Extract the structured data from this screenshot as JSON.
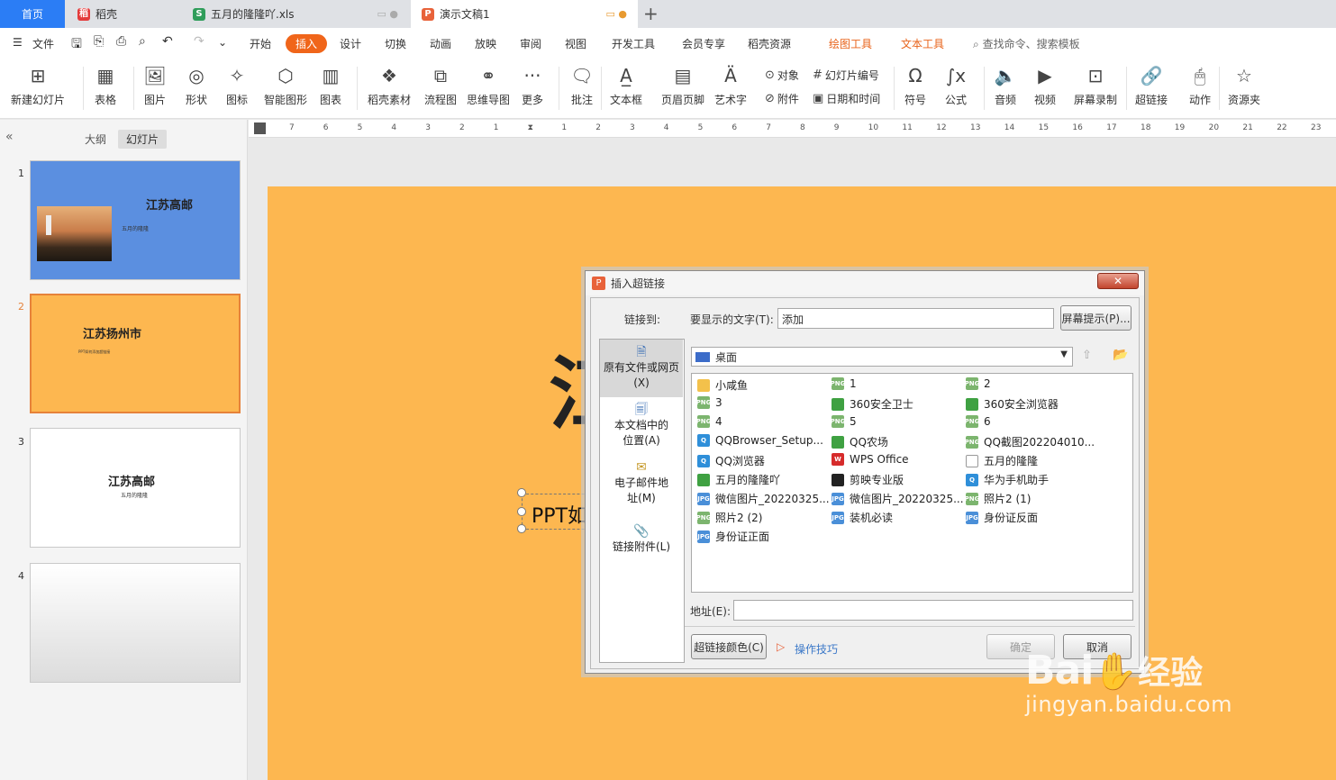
{
  "tabs": {
    "home": "首页",
    "daoke": "稻壳",
    "xls": "五月的隆隆吖.xls",
    "ppt": "演示文稿1"
  },
  "menu": {
    "file": "文件",
    "items": [
      "开始",
      "插入",
      "设计",
      "切换",
      "动画",
      "放映",
      "审阅",
      "视图",
      "开发工具",
      "会员专享",
      "稻壳资源"
    ],
    "draw": "绘图工具",
    "text": "文本工具",
    "search": "查找命令、搜索模板"
  },
  "ribbon": {
    "new_slide": "新建幻灯片",
    "table": "表格",
    "picture": "图片",
    "shape": "形状",
    "icon": "图标",
    "smart": "智能图形",
    "chart": "图表",
    "material": "稻壳素材",
    "flow": "流程图",
    "mind": "思维导图",
    "more": "更多",
    "comment": "批注",
    "textbox": "文本框",
    "header": "页眉页脚",
    "art": "艺术字",
    "object": "对象",
    "attach": "附件",
    "slide_num": "幻灯片编号",
    "datetime": "日期和时间",
    "symbol": "符号",
    "formula": "公式",
    "audio": "音频",
    "video": "视频",
    "screen": "屏幕录制",
    "link": "超链接",
    "action": "动作",
    "resource": "资源夹"
  },
  "panel": {
    "outline": "大纲",
    "slides": "幻灯片",
    "thumbs": [
      {
        "num": "1",
        "title": "江苏高邮",
        "sub": "五月的隆隆"
      },
      {
        "num": "2",
        "title": "江苏扬州市",
        "sub": "PPT如何添加超链接"
      },
      {
        "num": "3",
        "title": "江苏高邮",
        "sub": "五月的隆隆"
      },
      {
        "num": "4",
        "title": "",
        "sub": ""
      }
    ]
  },
  "ruler": [
    "7",
    "6",
    "5",
    "4",
    "3",
    "2",
    "1",
    "",
    "1",
    "2",
    "3",
    "4",
    "5",
    "6",
    "7",
    "8",
    "9",
    "10",
    "11",
    "12",
    "13",
    "14",
    "15",
    "16",
    "17",
    "18",
    "19",
    "20",
    "21",
    "22",
    "23"
  ],
  "slide": {
    "big_char": "江",
    "text": "PPT如"
  },
  "dialog": {
    "title": "插入超链接",
    "link_to": "链接到:",
    "display_label": "要显示的文字(T):",
    "display_value": "添加",
    "screen_tip": "屏幕提示(P)...",
    "location": "桌面",
    "side": [
      "原有文件或网页(X)",
      "本文档中的位置(A)",
      "电子邮件地址(M)",
      "链接附件(L)"
    ],
    "files": [
      {
        "name": "小咸鱼",
        "t": "fold"
      },
      {
        "name": "1",
        "t": "png"
      },
      {
        "name": "2",
        "t": "png"
      },
      {
        "name": "3",
        "t": "png"
      },
      {
        "name": "360安全卫士",
        "t": "green"
      },
      {
        "name": "360安全浏览器",
        "t": "green"
      },
      {
        "name": "4",
        "t": "png"
      },
      {
        "name": "5",
        "t": "png"
      },
      {
        "name": "6",
        "t": "png"
      },
      {
        "name": "QQBrowser_Setup...",
        "t": "app"
      },
      {
        "name": "QQ农场",
        "t": "green"
      },
      {
        "name": "QQ截图202204010...",
        "t": "png"
      },
      {
        "name": "QQ浏览器",
        "t": "app"
      },
      {
        "name": "WPS Office",
        "t": "red"
      },
      {
        "name": "五月的隆隆",
        "t": "doc"
      },
      {
        "name": "五月的隆隆吖",
        "t": "green"
      },
      {
        "name": "剪映专业版",
        "t": "dark"
      },
      {
        "name": "华为手机助手",
        "t": "app"
      },
      {
        "name": "微信图片_20220325...",
        "t": "jpg"
      },
      {
        "name": "微信图片_20220325...",
        "t": "jpg"
      },
      {
        "name": "照片2 (1)",
        "t": "png"
      },
      {
        "name": "照片2 (2)",
        "t": "png"
      },
      {
        "name": "装机必读",
        "t": "jpg"
      },
      {
        "name": "身份证反面",
        "t": "jpg"
      },
      {
        "name": "身份证正面",
        "t": "jpg"
      }
    ],
    "address_label": "地址(E):",
    "color_btn": "超链接颜色(C)",
    "tips": "操作技巧",
    "ok": "确定",
    "cancel": "取消"
  },
  "watermark": {
    "brand": "Bai",
    "suffix": "经验",
    "url": "jingyan.baidu.com"
  }
}
